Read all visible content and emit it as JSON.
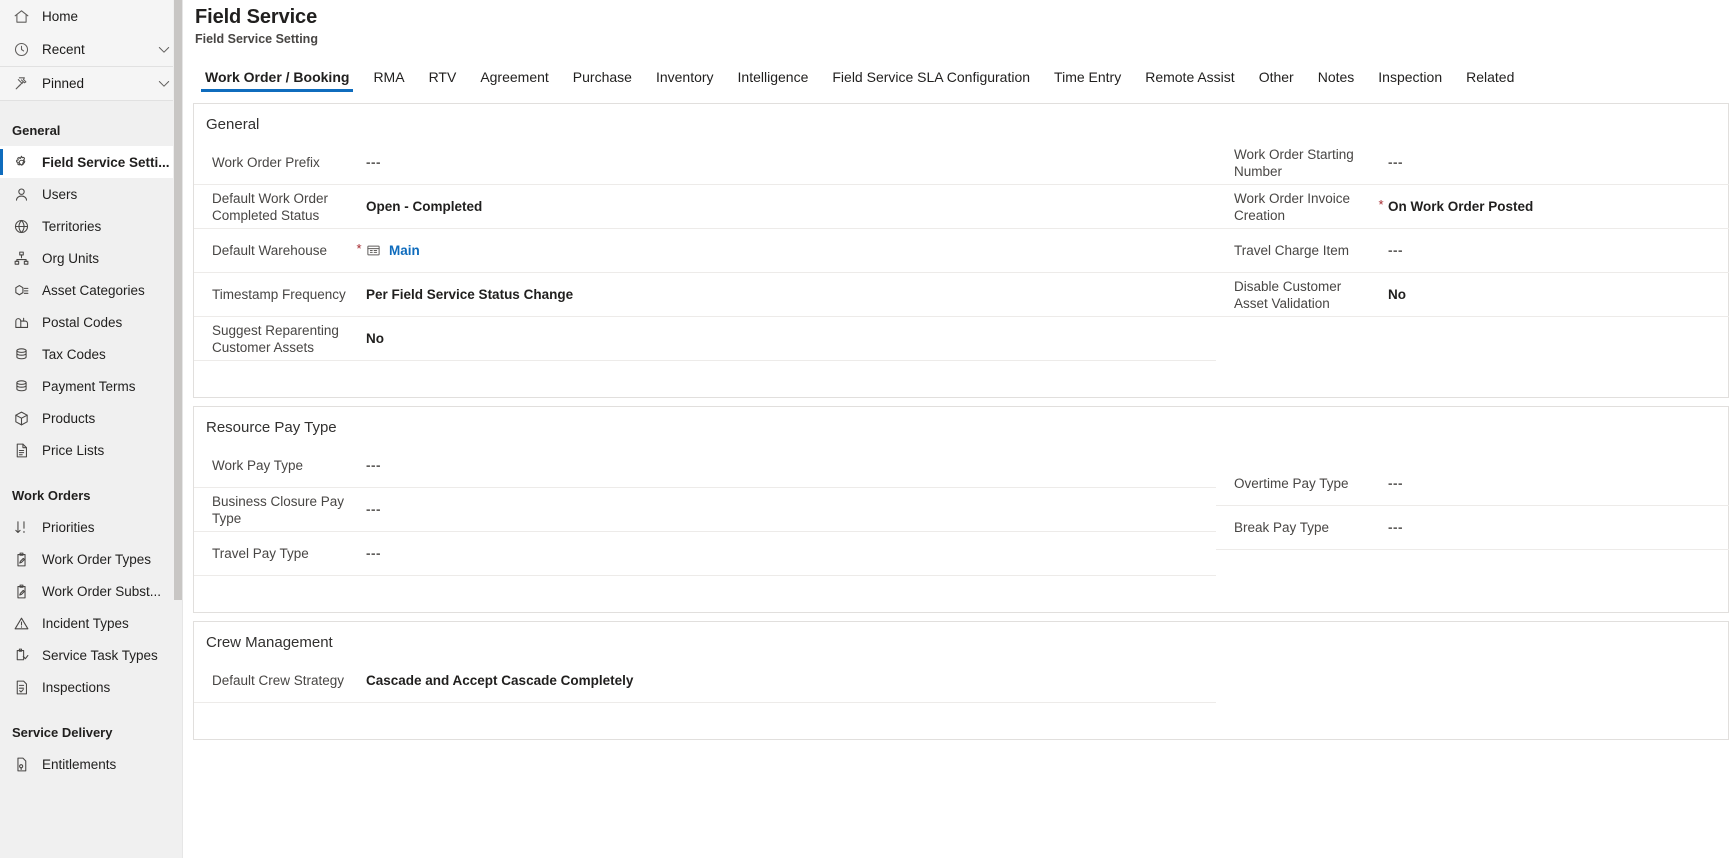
{
  "sidebar": {
    "top_items": [
      {
        "label": "Home",
        "icon": "home-icon",
        "chevron": false
      },
      {
        "label": "Recent",
        "icon": "clock-icon",
        "chevron": true
      },
      {
        "label": "Pinned",
        "icon": "pin-icon",
        "chevron": true
      }
    ],
    "groups": [
      {
        "title": "General",
        "items": [
          {
            "label": "Field Service Setti...",
            "icon": "gear-icon",
            "selected": true
          },
          {
            "label": "Users",
            "icon": "person-icon",
            "selected": false
          },
          {
            "label": "Territories",
            "icon": "globe-icon",
            "selected": false
          },
          {
            "label": "Org Units",
            "icon": "org-chart-icon",
            "selected": false
          },
          {
            "label": "Asset Categories",
            "icon": "asset-box-icon",
            "selected": false
          },
          {
            "label": "Postal Codes",
            "icon": "mailbox-icon",
            "selected": false
          },
          {
            "label": "Tax Codes",
            "icon": "stack-icon",
            "selected": false
          },
          {
            "label": "Payment Terms",
            "icon": "stack-icon",
            "selected": false
          },
          {
            "label": "Products",
            "icon": "package-icon",
            "selected": false
          },
          {
            "label": "Price Lists",
            "icon": "document-list-icon",
            "selected": false
          }
        ]
      },
      {
        "title": "Work Orders",
        "items": [
          {
            "label": "Priorities",
            "icon": "sort-priority-icon",
            "selected": false
          },
          {
            "label": "Work Order Types",
            "icon": "clipboard-pen-icon",
            "selected": false
          },
          {
            "label": "Work Order Subst...",
            "icon": "clipboard-pen-icon",
            "selected": false
          },
          {
            "label": "Incident Types",
            "icon": "warning-triangle-icon",
            "selected": false
          },
          {
            "label": "Service Task Types",
            "icon": "clipboard-task-icon",
            "selected": false
          },
          {
            "label": "Inspections",
            "icon": "checklist-icon",
            "selected": false
          }
        ]
      },
      {
        "title": "Service Delivery",
        "items": [
          {
            "label": "Entitlements",
            "icon": "entitlement-icon",
            "selected": false
          }
        ]
      }
    ]
  },
  "header": {
    "title": "Field Service",
    "subtitle": "Field Service Setting"
  },
  "tabs": [
    {
      "label": "Work Order / Booking",
      "active": true
    },
    {
      "label": "RMA",
      "active": false
    },
    {
      "label": "RTV",
      "active": false
    },
    {
      "label": "Agreement",
      "active": false
    },
    {
      "label": "Purchase",
      "active": false
    },
    {
      "label": "Inventory",
      "active": false
    },
    {
      "label": "Intelligence",
      "active": false
    },
    {
      "label": "Field Service SLA Configuration",
      "active": false
    },
    {
      "label": "Time Entry",
      "active": false
    },
    {
      "label": "Remote Assist",
      "active": false
    },
    {
      "label": "Other",
      "active": false
    },
    {
      "label": "Notes",
      "active": false
    },
    {
      "label": "Inspection",
      "active": false
    },
    {
      "label": "Related",
      "active": false
    }
  ],
  "sections": [
    {
      "title": "General",
      "left_fields": [
        {
          "label": "Work Order Prefix",
          "value": "---",
          "empty": true,
          "required": false,
          "link": false
        },
        {
          "label": "Default Work Order Completed Status",
          "value": "Open - Completed",
          "empty": false,
          "required": false,
          "link": false
        },
        {
          "label": "Default Warehouse",
          "value": "Main",
          "empty": false,
          "required": true,
          "link": true,
          "icon": "lookup-record-icon"
        },
        {
          "label": "Timestamp Frequency",
          "value": "Per Field Service Status Change",
          "empty": false,
          "required": false,
          "link": false
        },
        {
          "label": "Suggest Reparenting Customer Assets",
          "value": "No",
          "empty": false,
          "required": false,
          "link": false
        }
      ],
      "right_fields": [
        {
          "label": "Work Order Starting Number",
          "value": "---",
          "empty": true,
          "required": false,
          "link": false
        },
        {
          "label": "Work Order Invoice Creation",
          "value": "On Work Order Posted",
          "empty": false,
          "required": true,
          "link": false
        },
        {
          "label": "Travel Charge Item",
          "value": "---",
          "empty": true,
          "required": false,
          "link": false
        },
        {
          "label": "Disable Customer Asset Validation",
          "value": "No",
          "empty": false,
          "required": false,
          "link": false
        }
      ]
    },
    {
      "title": "Resource Pay Type",
      "left_fields": [
        {
          "label": "Work Pay Type",
          "value": "---",
          "empty": true,
          "required": false,
          "link": false
        },
        {
          "label": "Business Closure Pay Type",
          "value": "---",
          "empty": true,
          "required": false,
          "link": false
        },
        {
          "label": "Travel Pay Type",
          "value": "---",
          "empty": true,
          "required": false,
          "link": false
        }
      ],
      "right_fields": [
        {
          "label": "Overtime Pay Type",
          "value": "---",
          "empty": true,
          "required": false,
          "link": false
        },
        {
          "label": "Break Pay Type",
          "value": "---",
          "empty": true,
          "required": false,
          "link": false
        }
      ]
    },
    {
      "title": "Crew Management",
      "left_fields": [
        {
          "label": "Default Crew Strategy",
          "value": "Cascade and Accept Cascade Completely",
          "empty": false,
          "required": false,
          "link": false
        }
      ],
      "right_fields": []
    }
  ],
  "colors": {
    "accent": "#0f6cbd",
    "required_star": "#a4262c",
    "sidebar_bg": "#f0f0f0",
    "divider": "#edebe9"
  }
}
